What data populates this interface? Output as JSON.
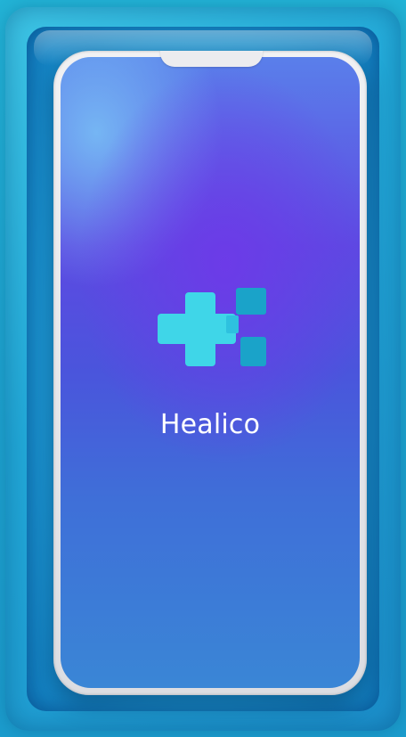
{
  "app": {
    "name": "Healico",
    "logo_icon": "healico-cross-logo-icon"
  },
  "colors": {
    "background": "#1ea4cf",
    "screen_top": "#5a7fea",
    "screen_mid": "#5d49e2",
    "screen_bottom": "#3a86d6",
    "logo_primary": "#3fd6e8",
    "logo_secondary": "#1aa3c9",
    "text": "#ffffff"
  }
}
